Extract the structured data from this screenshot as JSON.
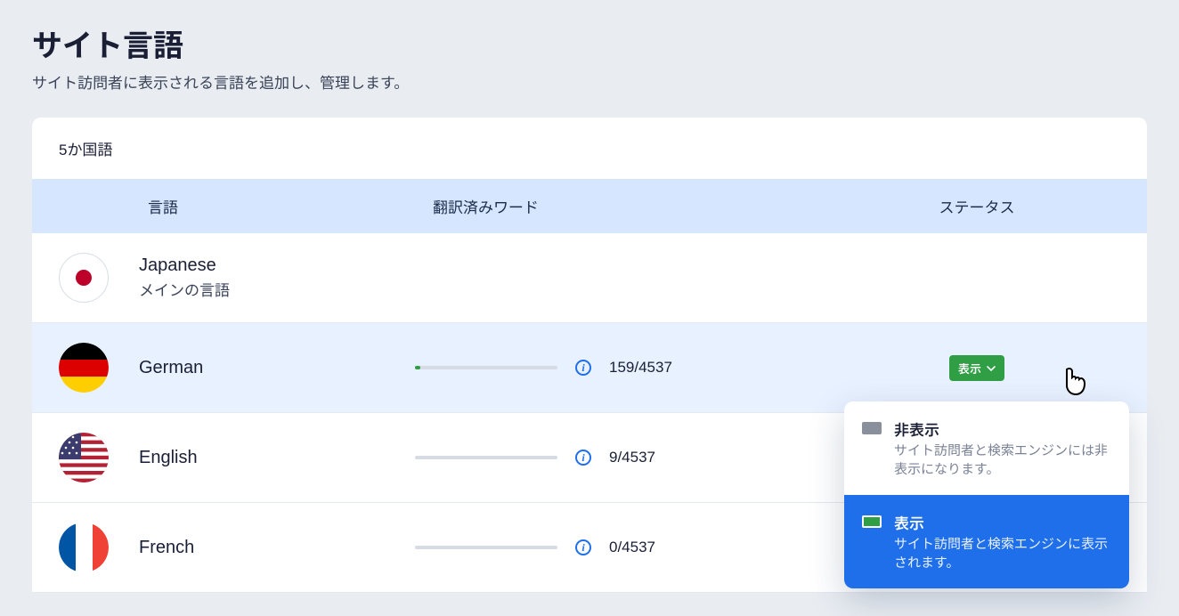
{
  "header": {
    "title": "サイト言語",
    "subtitle": "サイト訪問者に表示される言語を追加し、管理します。"
  },
  "panel": {
    "count_label": "5か国語",
    "columns": {
      "language": "言語",
      "translated_words": "翻訳済みワード",
      "status": "ステータス"
    }
  },
  "languages": [
    {
      "name": "Japanese",
      "subtitle": "メインの言語",
      "is_main": true
    },
    {
      "name": "German",
      "progress_pct": 3.5,
      "count": "159/4537",
      "status_label": "表示"
    },
    {
      "name": "English",
      "progress_pct": 0,
      "count": "9/4537"
    },
    {
      "name": "French",
      "progress_pct": 0,
      "count": "0/4537"
    }
  ],
  "dropdown": {
    "hidden": {
      "title": "非表示",
      "desc": "サイト訪問者と検索エンジンには非表示になります。"
    },
    "visible": {
      "title": "表示",
      "desc": "サイト訪問者と検索エンジンに表示されます。"
    }
  }
}
